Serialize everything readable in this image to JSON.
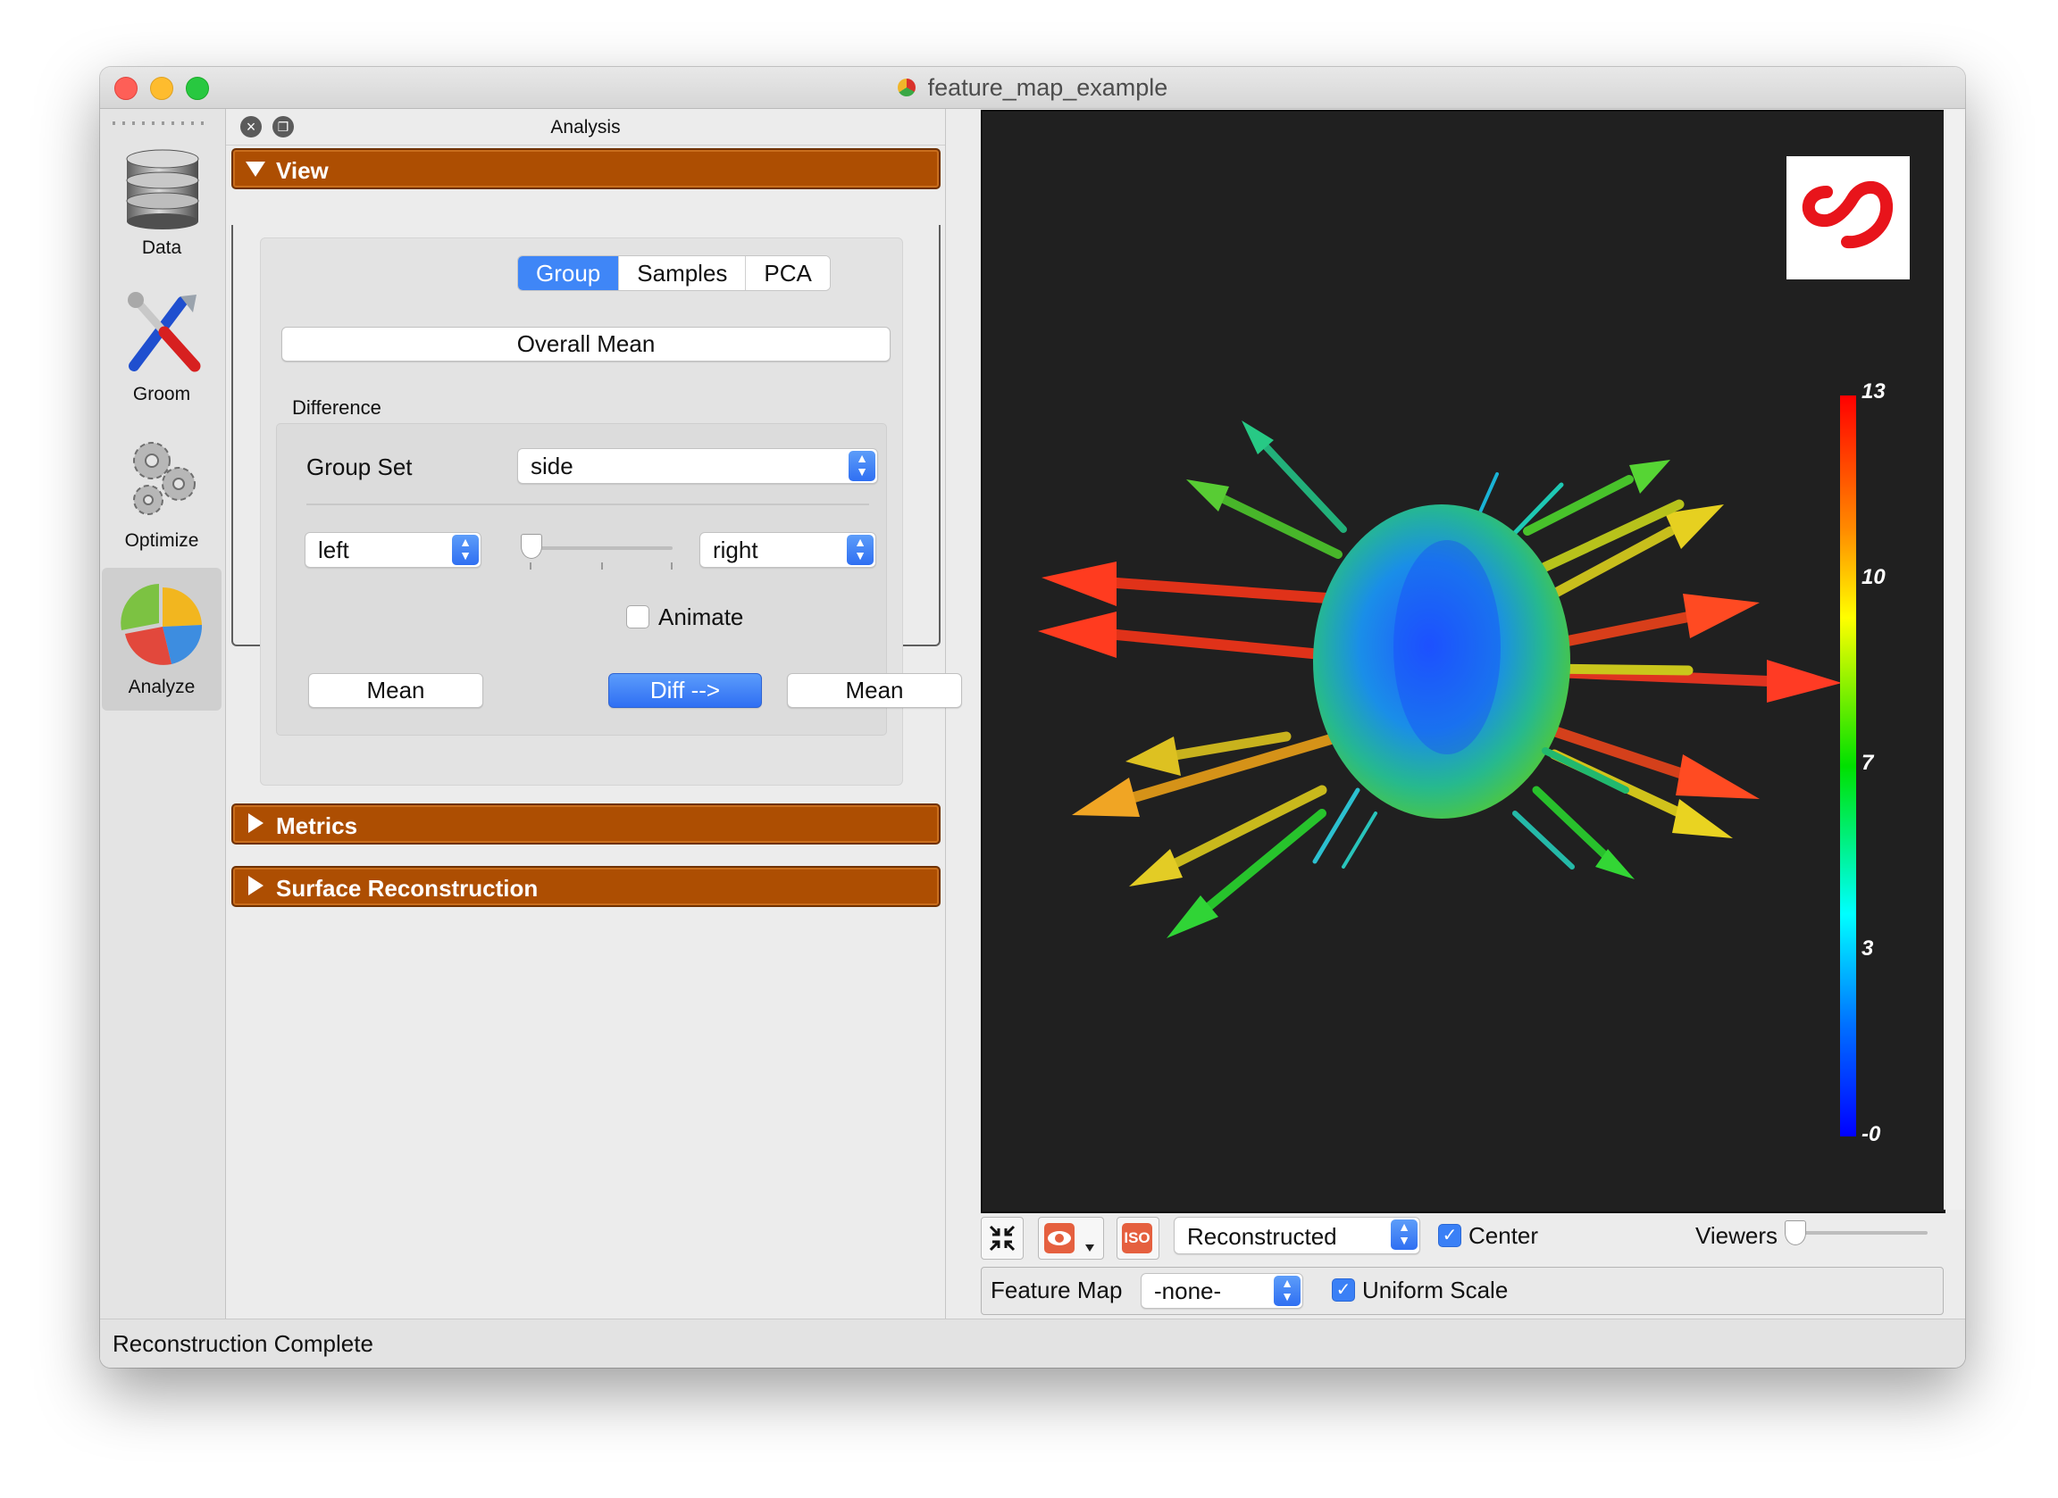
{
  "window": {
    "title": "feature_map_example"
  },
  "toolbar": {
    "items": [
      {
        "label": "Data"
      },
      {
        "label": "Groom"
      },
      {
        "label": "Optimize"
      },
      {
        "label": "Analyze"
      }
    ]
  },
  "panel": {
    "title": "Analysis",
    "sections": {
      "view": "View",
      "metrics": "Metrics",
      "surface": "Surface Reconstruction"
    },
    "tabs": [
      "Group",
      "Samples",
      "PCA"
    ],
    "overall_mean": "Overall Mean",
    "difference_label": "Difference",
    "group_set_label": "Group Set",
    "group_set_value": "side",
    "left_value": "left",
    "right_value": "right",
    "animate_label": "Animate",
    "mean_left": "Mean",
    "diff": "Diff -->",
    "mean_right": "Mean"
  },
  "viewer": {
    "colorbar_ticks": [
      "13",
      "10",
      "7",
      "3",
      "-0"
    ],
    "colors": {
      "background": "#202020",
      "logo_red": "#e8141b"
    }
  },
  "controls": {
    "display_mode": "Reconstructed",
    "center_label": "Center",
    "center_checked": true,
    "viewers_label": "Viewers",
    "feature_map_label": "Feature Map",
    "feature_map_value": "-none-",
    "uniform_scale_label": "Uniform Scale",
    "uniform_scale_checked": true,
    "iso_label": "ISO"
  },
  "status": {
    "text": "Reconstruction Complete"
  },
  "colors": {
    "accent": "#3f86f7",
    "section": "#ad4e02"
  }
}
